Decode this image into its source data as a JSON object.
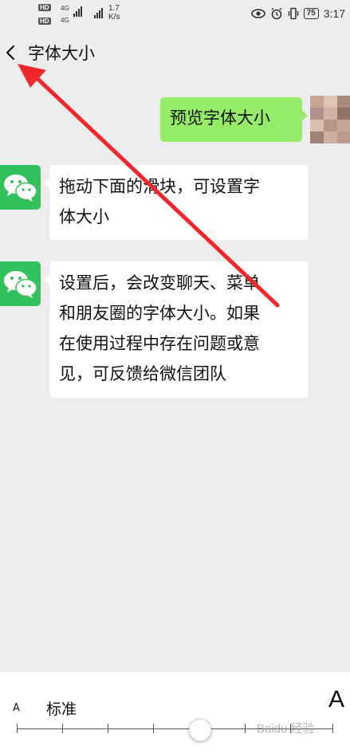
{
  "status_bar": {
    "hd1": "HD",
    "hd2": "HD",
    "sig1": "4G",
    "sig2": "4G",
    "speed_value": "1.7",
    "speed_unit": "K/s",
    "battery": "75",
    "time": "3:17"
  },
  "header": {
    "title": "字体大小"
  },
  "messages": [
    {
      "side": "right",
      "text": "预览字体大小"
    },
    {
      "side": "left",
      "lines": [
        "拖动下面的滑块，可设置字",
        "体大小"
      ]
    },
    {
      "side": "left",
      "lines": [
        "设置后，会改变聊天、菜单",
        "和朋友圈的字体大小。如果",
        "在使用过程中存在问题或意",
        "见，可反馈给微信团队"
      ]
    }
  ],
  "font_slider": {
    "small_label": "A",
    "current_label": "标准",
    "large_label": "A",
    "level_index": 3,
    "levels": 8
  },
  "watermark": "Baidu 经验",
  "colors": {
    "background": "#ededed",
    "sent_bubble": "#95ec69",
    "received_bubble": "#ffffff",
    "wechat_green": "#33c15b",
    "annotation_arrow": "#f0262b"
  }
}
